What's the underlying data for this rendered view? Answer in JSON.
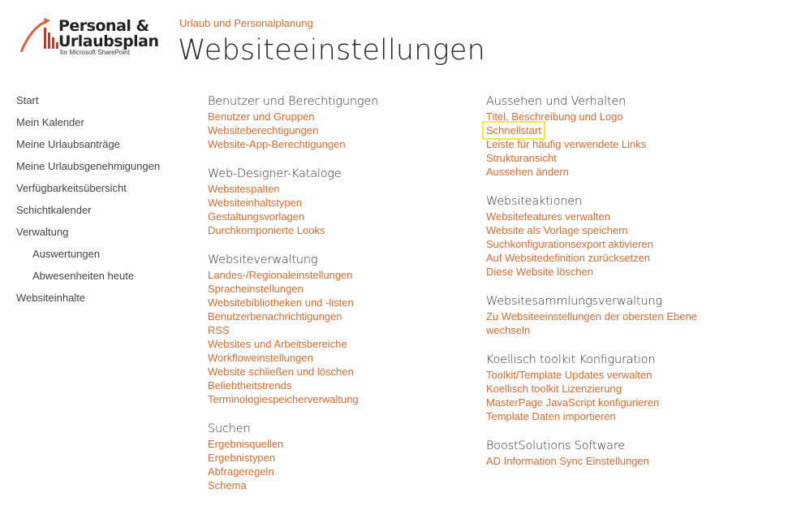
{
  "logo": {
    "line1": "Personal &",
    "line2": "Urlaubsplan",
    "sub": "for Microsoft SharePoint",
    "colors": {
      "accent": "#d9603b",
      "bars": "#c0392b"
    }
  },
  "breadcrumb": "Urlaub und Personalplanung",
  "page_title": "Websiteeinstellungen",
  "colors": {
    "link": "#d86b2f",
    "highlight": "#f2ea3b",
    "text": "#444444"
  },
  "quicklaunch": [
    {
      "label": "Start"
    },
    {
      "label": "Mein Kalender"
    },
    {
      "label": "Meine Urlaubsanträge"
    },
    {
      "label": "Meine Urlaubsgenehmigungen"
    },
    {
      "label": "Verfügbarkeitsübersicht"
    },
    {
      "label": "Schichtkalender"
    },
    {
      "label": "Verwaltung"
    },
    {
      "label": "Auswertungen"
    },
    {
      "label": "Abwesenheiten heute"
    },
    {
      "label": "Websiteinhalte"
    }
  ],
  "col1": [
    {
      "title": "Benutzer und Berechtigungen",
      "links": [
        "Benutzer und Gruppen",
        "Websiteberechtigungen",
        "Website-App-Berechtigungen"
      ]
    },
    {
      "title": "Web-Designer-Kataloge",
      "links": [
        "Websitespalten",
        "Websiteinhaltstypen",
        "Gestaltungsvorlagen",
        "Durchkomponierte Looks"
      ]
    },
    {
      "title": "Websiteverwaltung",
      "links": [
        "Landes-/Regionaleinstellungen",
        "Spracheinstellungen",
        "Websitebibliotheken und -listen",
        "Benutzerbenachrichtigungen",
        "RSS",
        "Websites und Arbeitsbereiche",
        "Workfloweinstellungen",
        "Website schließen und löschen",
        "Beliebtheitstrends",
        "Terminologiespeicherverwaltung"
      ]
    },
    {
      "title": "Suchen",
      "links": [
        "Ergebnisquellen",
        "Ergebnistypen",
        "Abfrageregeln",
        "Schema"
      ]
    }
  ],
  "col2": [
    {
      "title": "Aussehen und Verhalten",
      "links": [
        "Titel, Beschreibung und Logo",
        "Schnellstart",
        "Leiste für häufig verwendete Links",
        "Strukturansicht",
        "Aussehen ändern"
      ]
    },
    {
      "title": "Websiteaktionen",
      "links": [
        "Websitefeatures verwalten",
        "Website als Vorlage speichern",
        "Suchkonfigurationsexport aktivieren",
        "Auf Websitedefinition zurücksetzen",
        "Diese Website löschen"
      ]
    },
    {
      "title": "Websitesammlungsverwaltung",
      "links": [
        "Zu Websiteeinstellungen der obersten Ebene wechseln"
      ]
    },
    {
      "title": "Koellisch toolkit Konfiguration",
      "links": [
        "Toolkit/Template Updates verwalten",
        "Koellisch toolkit Lizenzierung",
        "MasterPage JavaScript konfigurieren",
        "Template Daten importieren"
      ]
    },
    {
      "title": "BoostSolutions Software",
      "links": [
        "AD Information Sync Einstellungen"
      ]
    }
  ]
}
